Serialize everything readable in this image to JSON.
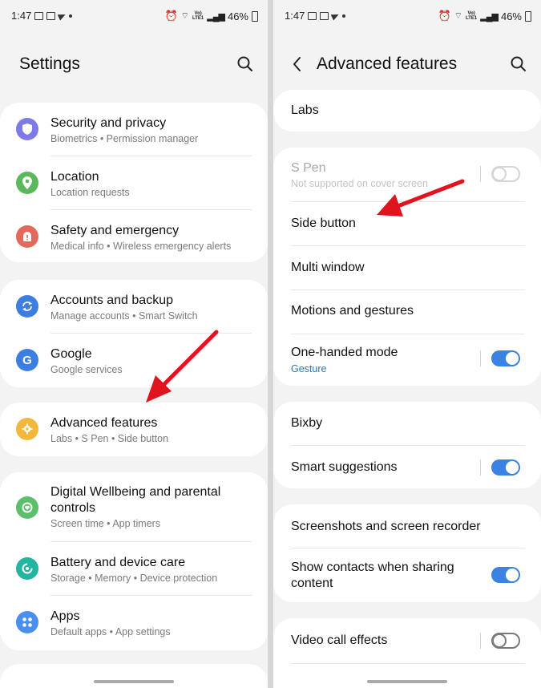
{
  "left": {
    "status": {
      "time": "1:47",
      "battery": "46%",
      "net": "VoLTE LTE1"
    },
    "title": "Settings",
    "sections": [
      [
        {
          "title": "Security and privacy",
          "subtitle": "Biometrics  •  Permission manager",
          "icon": "shield-icon",
          "color": "#7d7ae8"
        },
        {
          "title": "Location",
          "subtitle": "Location requests",
          "icon": "location-pin-icon",
          "color": "#5cb85c"
        },
        {
          "title": "Safety and emergency",
          "subtitle": "Medical info  •  Wireless emergency alerts",
          "icon": "emergency-icon",
          "color": "#e26a5c"
        }
      ],
      [
        {
          "title": "Accounts and backup",
          "subtitle": "Manage accounts  •  Smart Switch",
          "icon": "sync-icon",
          "color": "#3d7fe0"
        },
        {
          "title": "Google",
          "subtitle": "Google services",
          "icon": "google-icon",
          "color": "#3d7fe0"
        }
      ],
      [
        {
          "title": "Advanced features",
          "subtitle": "Labs  •  S Pen  •  Side button",
          "icon": "puzzle-gear-icon",
          "color": "#f3b73d"
        }
      ],
      [
        {
          "title": "Digital Wellbeing and parental controls",
          "subtitle": "Screen time  •  App timers",
          "icon": "wellbeing-icon",
          "color": "#5bbf6b"
        },
        {
          "title": "Battery and device care",
          "subtitle": "Storage  •  Memory  •  Device protection",
          "icon": "device-care-icon",
          "color": "#22b5a0"
        },
        {
          "title": "Apps",
          "subtitle": "Default apps  •  App settings",
          "icon": "apps-grid-icon",
          "color": "#4a8ef0"
        }
      ]
    ]
  },
  "right": {
    "status": {
      "time": "1:47",
      "battery": "46%",
      "net": "VoLTE LTE1"
    },
    "title": "Advanced features",
    "labs": "Labs",
    "spen": {
      "title": "S Pen",
      "subtitle": "Not supported on cover screen",
      "toggle": false
    },
    "side_button": "Side button",
    "multi_window": "Multi window",
    "motions": "Motions and gestures",
    "one_handed": {
      "title": "One-handed mode",
      "subtitle": "Gesture",
      "toggle": true
    },
    "bixby": "Bixby",
    "smart_suggestions": {
      "title": "Smart suggestions",
      "toggle": true
    },
    "screenshots": "Screenshots and screen recorder",
    "show_contacts": {
      "title": "Show contacts when sharing content",
      "toggle": true
    },
    "video_call": {
      "title": "Video call effects",
      "toggle": false
    }
  },
  "colors": {
    "arrow": "#e0141f",
    "toggle_on": "#3b83e2",
    "accent_text": "#2f79b8"
  }
}
